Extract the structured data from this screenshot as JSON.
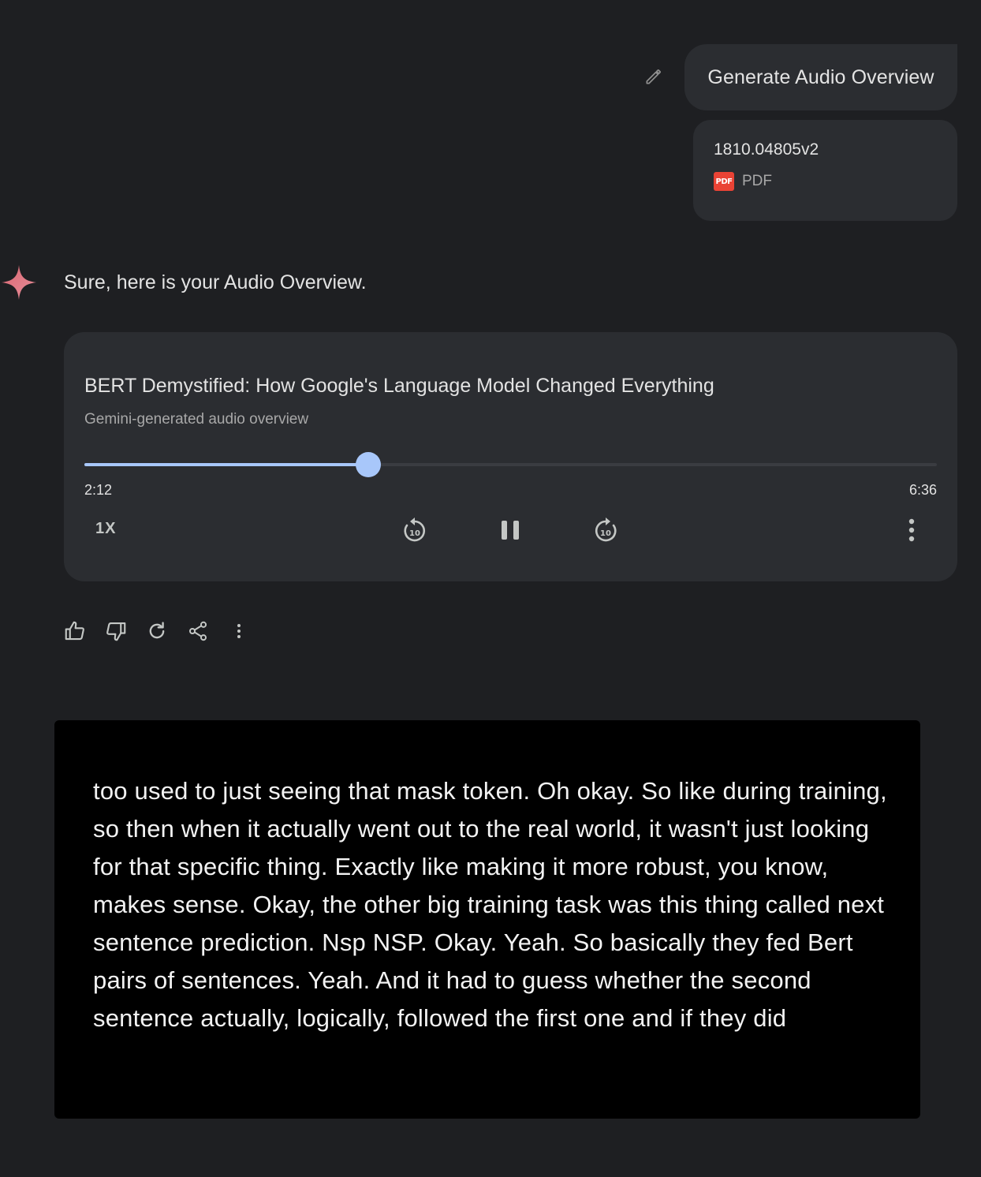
{
  "user_prompt": {
    "text": "Generate Audio Overview",
    "attachment": {
      "name": "1810.04805v2",
      "type_label": "PDF",
      "icon_label": "PDF"
    }
  },
  "assistant": {
    "intro": "Sure, here is your Audio Overview.",
    "audio": {
      "title": "BERT Demystified: How Google's Language Model Changed Everything",
      "subtitle": "Gemini-generated audio overview",
      "current_time": "2:12",
      "total_time": "6:36",
      "progress": 0.333,
      "speed": "1X",
      "skip_seconds": "10"
    }
  },
  "transcript": "too used to just seeing that mask token. Oh okay. So like during training, so then when it actually went out to the real world, it wasn't just looking for that specific thing. Exactly like making it more robust, you know, makes sense. Okay, the other big training task was this thing called next sentence prediction. Nsp NSP. Okay. Yeah. So basically they fed Bert pairs of sentences. Yeah. And it had to guess whether the second sentence actually, logically, followed the first one and if they did",
  "colors": {
    "accent": "#a8c7fa",
    "background": "#1e1f22",
    "surface": "#2b2d31",
    "pdf_red": "#ea4335"
  },
  "icons": [
    "edit-icon",
    "pdf-icon",
    "gemini-sparkle-icon",
    "replay-10-icon",
    "pause-icon",
    "forward-10-icon",
    "more-vert-icon",
    "thumb-up-icon",
    "thumb-down-icon",
    "refresh-icon",
    "share-icon"
  ]
}
